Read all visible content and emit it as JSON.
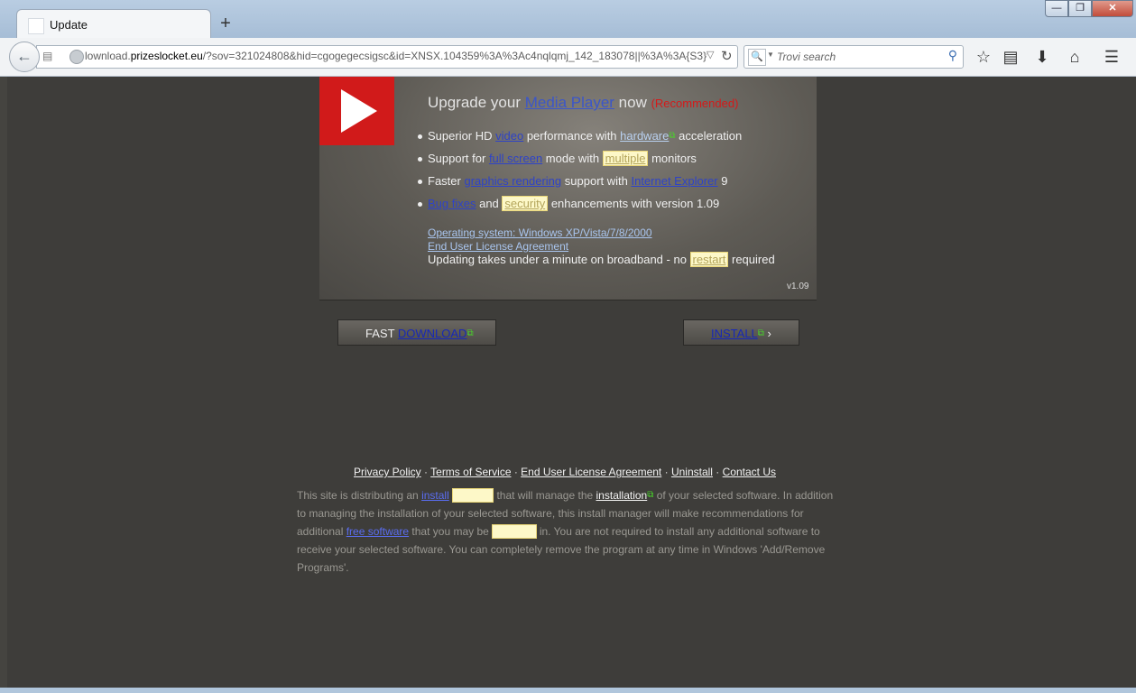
{
  "window": {
    "tab_title": "Update",
    "new_tab": "+",
    "minimize": "—",
    "maximize": "❐",
    "close": "✕"
  },
  "nav": {
    "url_prefix": "lownload.",
    "url_domain": "prizeslocket.eu",
    "url_rest": "/?sov=321024808&hid=cgogegecsigsc&id=XNSX.104359%3A%3Ac4nqlqmj_142_183078||%3A%3A{S3}%3",
    "search_placeholder": "Trovi search",
    "icons": [
      "back-arrow-icon",
      "star-icon",
      "reading-list-icon",
      "download-icon",
      "home-icon",
      "menu-icon"
    ]
  },
  "promo": {
    "headline_pre": "Upgrade your ",
    "headline_link": "Media Player",
    "headline_post": " now ",
    "recommended": "(Recommended)",
    "bullets": [
      {
        "a": "Superior HD ",
        "b": "video",
        "c": " performance with ",
        "d": "hardware",
        "e": " acceleration"
      },
      {
        "a": "Support for ",
        "b": "full screen",
        "c": " mode with ",
        "d": "multiple",
        "e": " monitors"
      },
      {
        "a": "Faster ",
        "b": "graphics rendering",
        "c": " support with ",
        "d": "Internet Explorer",
        "e": " 9"
      },
      {
        "a": "",
        "b": "Bug fixes",
        "c": " and ",
        "d": "security",
        "e": " enhancements with version 1.09"
      }
    ],
    "os_link": "Operating system: Windows XP/Vista/7/8/2000",
    "eula_link": "End User License Agreement",
    "update_pre": "Updating takes under a minute on broadband - no ",
    "update_link": "restart",
    "update_post": " required",
    "version": "v1.09"
  },
  "buttons": {
    "fast_pre": "FAST ",
    "fast_link": "DOWNLOAD",
    "install_link": "INSTALL",
    "install_arrow": " ›"
  },
  "footer": {
    "links": [
      "Privacy Policy",
      "Terms of Service",
      "End User License Agreement",
      "Uninstall",
      "Contact Us"
    ],
    "sep": " · ",
    "d1": "This site is distributing an ",
    "d_install": "install",
    "d2": " that will manage the ",
    "d_installation": "installation",
    "d3": " of your selected software. In addition to managing the installation of your selected software, this install manager will make recommendations for additional ",
    "d_free": "free software",
    "d4": " that you may be ",
    "d5": " in. You are not required to install any additional software to receive your selected software. You can completely remove the program at any time in Windows 'Add/Remove Programs'."
  },
  "colors": {
    "page_bg": "#3e3d3a",
    "promo_red": "#d11a1a",
    "link_blue": "#2e43c7",
    "external_green": "#49d52a"
  }
}
